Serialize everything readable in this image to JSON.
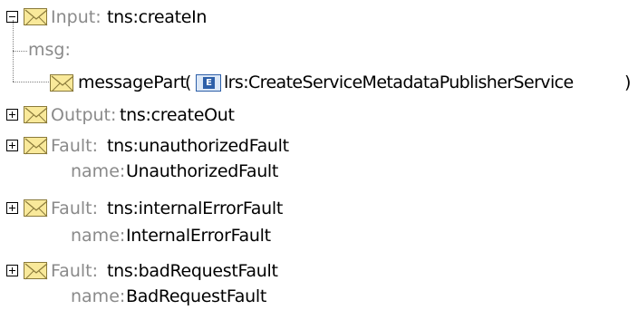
{
  "input": {
    "label": "Input:",
    "value": "tns:createIn",
    "msg_label": "msg:",
    "part_name": "messagePart",
    "paren_open": "(",
    "element_badge": "E",
    "element_type": "lrs:CreateServiceMetadataPublisherService",
    "paren_close": ")"
  },
  "output": {
    "label": "Output:",
    "value": "tns:createOut"
  },
  "faults": [
    {
      "label": "Fault:",
      "value": "tns:unauthorizedFault",
      "name_label": "name:",
      "name_value": "UnauthorizedFault"
    },
    {
      "label": "Fault:",
      "value": "tns:internalErrorFault",
      "name_label": "name:",
      "name_value": "InternalErrorFault"
    },
    {
      "label": "Fault:",
      "value": "tns:badRequestFault",
      "name_label": "name:",
      "name_value": "BadRequestFault"
    }
  ],
  "icons": {
    "expand": "plus-box-icon",
    "collapse": "minus-box-icon",
    "message": "envelope-icon",
    "element": "element-e-icon"
  },
  "colors": {
    "label_gray": "#8a8a8a",
    "envelope_fill": "#f9e99a",
    "element_blue": "#2d5fa8"
  }
}
